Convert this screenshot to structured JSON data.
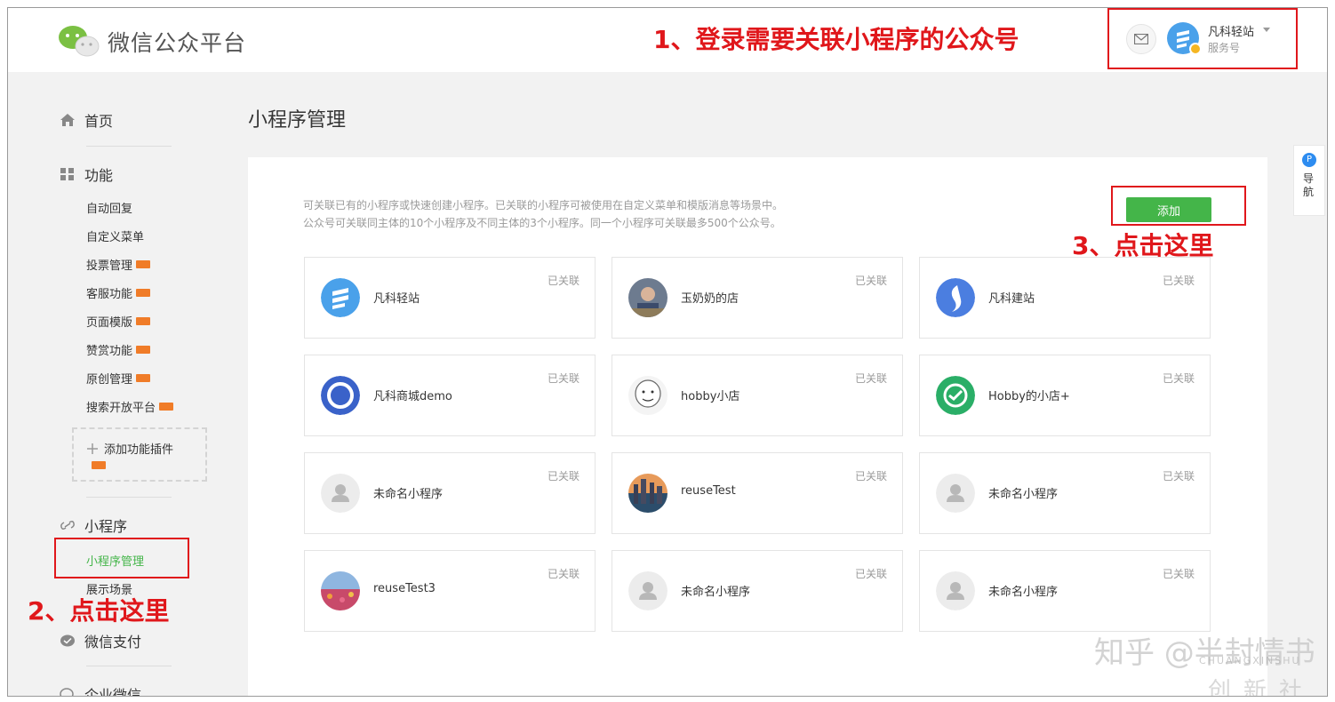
{
  "header": {
    "logo_text": "微信公众平台",
    "account_name": "凡科轻站",
    "account_type": "服务号"
  },
  "annotations": {
    "step1": "1、登录需要关联小程序的公众号",
    "step2": "2、点击这里",
    "step3": "3、点击这里"
  },
  "sidebar": {
    "home": "首页",
    "features": "功能",
    "feature_items": [
      "自动回复",
      "自定义菜单",
      "投票管理",
      "客服功能",
      "页面模版",
      "赞赏功能",
      "原创管理",
      "搜索开放平台"
    ],
    "add_plugin": "添加功能插件",
    "miniprogram": "小程序",
    "miniprogram_items": [
      "小程序管理",
      "展示场景"
    ],
    "wechat_pay": "微信支付",
    "enterprise_wechat": "企业微信"
  },
  "main": {
    "title": "小程序管理",
    "desc_line1": "可关联已有的小程序或快速创建小程序。已关联的小程序可被使用在自定义菜单和模版消息等场景中。",
    "desc_line2": "公众号可关联同主体的10个小程序及不同主体的3个小程序。同一个小程序可关联最多500个公众号。",
    "add_button": "添加",
    "status_label": "已关联",
    "cards": [
      {
        "name": "凡科轻站",
        "avatar": "fanke-light-logo"
      },
      {
        "name": "玉奶奶的店",
        "avatar": "photo-avatar"
      },
      {
        "name": "凡科建站",
        "avatar": "fanke-build-logo"
      },
      {
        "name": "凡科商城demo",
        "avatar": "fanke-mall-logo"
      },
      {
        "name": "hobby小店",
        "avatar": "meme-face-avatar"
      },
      {
        "name": "Hobby的小店+",
        "avatar": "wechat-green-logo"
      },
      {
        "name": "未命名小程序",
        "avatar": "default-user-avatar"
      },
      {
        "name": "reuseTest",
        "avatar": "city-photo-avatar"
      },
      {
        "name": "未命名小程序",
        "avatar": "default-user-avatar"
      },
      {
        "name": "reuseTest3",
        "avatar": "flower-field-avatar"
      },
      {
        "name": "未命名小程序",
        "avatar": "default-user-avatar"
      },
      {
        "name": "未命名小程序",
        "avatar": "default-user-avatar"
      }
    ]
  },
  "float_nav": {
    "badge": "P",
    "label": "导航"
  },
  "watermark": {
    "main": "知乎 @半封情书",
    "sub": "CHUANGXINSHU",
    "logo": "创新社"
  },
  "colors": {
    "accent_green": "#44b549",
    "annotation_red": "#e0171b",
    "beta_orange": "#f07c28"
  }
}
